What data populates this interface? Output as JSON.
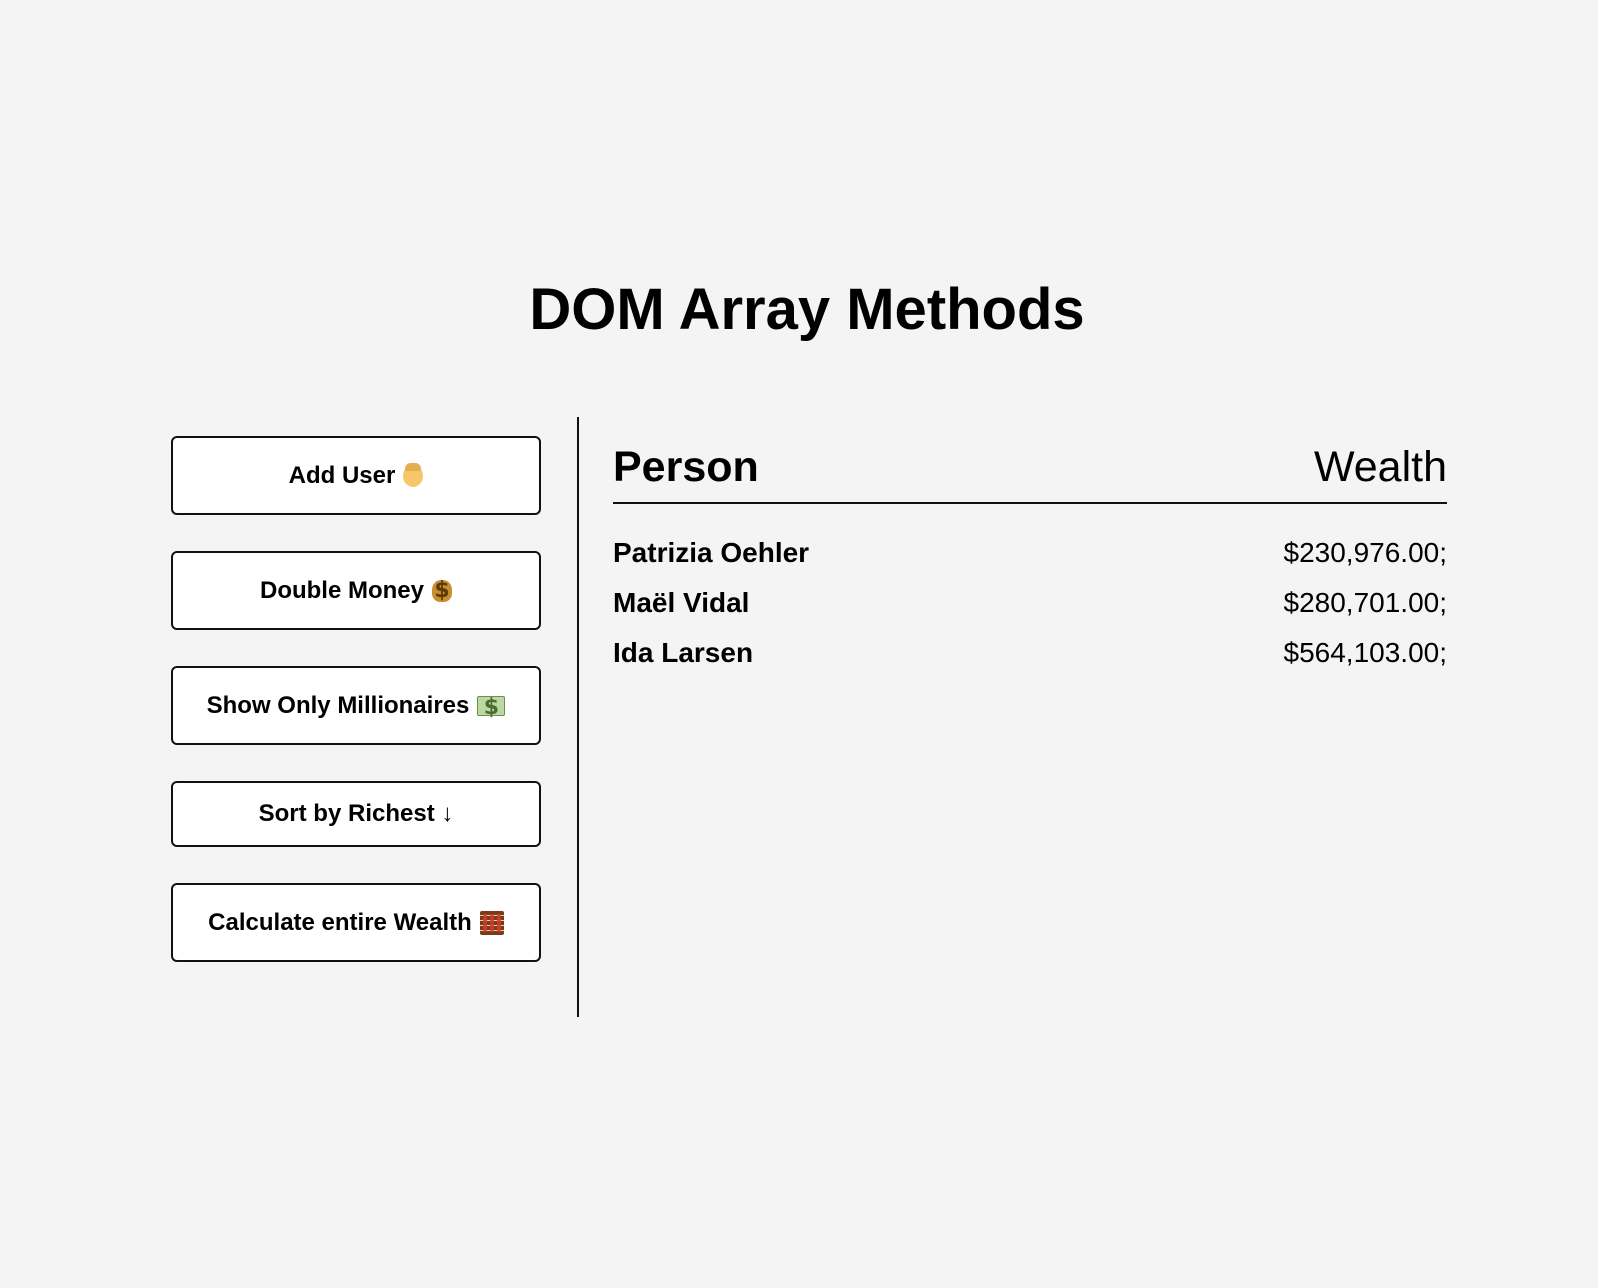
{
  "page": {
    "title": "DOM Array Methods"
  },
  "sidebar": {
    "buttons": [
      {
        "label": "Add User",
        "icon": "man-emoji-icon"
      },
      {
        "label": "Double Money",
        "icon": "money-bag-emoji-icon"
      },
      {
        "label": "Show Only Millionaires",
        "icon": "dollar-banknote-emoji-icon"
      },
      {
        "label": "Sort by Richest ↓",
        "icon": ""
      },
      {
        "label": "Calculate entire Wealth",
        "icon": "abacus-emoji-icon"
      }
    ]
  },
  "table": {
    "headers": {
      "person": "Person",
      "wealth": "Wealth"
    },
    "rows": [
      {
        "name": "Patrizia Oehler",
        "wealth": "$230,976.00;"
      },
      {
        "name": "Maël Vidal",
        "wealth": "$280,701.00;"
      },
      {
        "name": "Ida Larsen",
        "wealth": "$564,103.00;"
      }
    ]
  },
  "colors": {
    "background": "#f4f4f4",
    "button_background": "#ffffff",
    "border": "#111111",
    "text": "#000000"
  }
}
